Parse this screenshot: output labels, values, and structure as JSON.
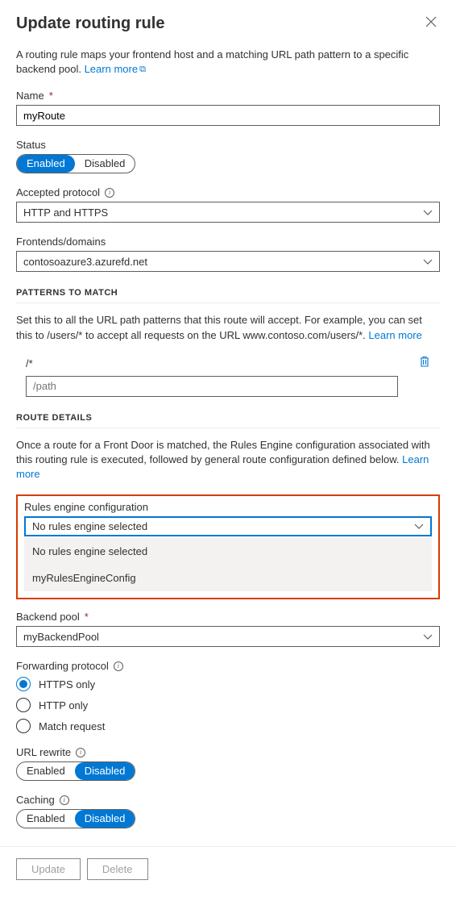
{
  "header": {
    "title": "Update routing rule"
  },
  "intro": {
    "text": "A routing rule maps your frontend host and a matching URL path pattern to a specific backend pool. ",
    "learn_more": "Learn more"
  },
  "name": {
    "label": "Name",
    "value": "myRoute"
  },
  "status": {
    "label": "Status",
    "enabled": "Enabled",
    "disabled": "Disabled"
  },
  "accepted_protocol": {
    "label": "Accepted protocol",
    "value": "HTTP and HTTPS"
  },
  "frontends": {
    "label": "Frontends/domains",
    "value": "contosoazure3.azurefd.net"
  },
  "patterns": {
    "heading": "PATTERNS TO MATCH",
    "desc": "Set this to all the URL path patterns that this route will accept. For example, you can set this to /users/* to accept all requests on the URL www.contoso.com/users/*. ",
    "learn_more": "Learn more",
    "existing": "/*",
    "placeholder": "/path"
  },
  "route_details": {
    "heading": "ROUTE DETAILS",
    "desc": "Once a route for a Front Door is matched, the Rules Engine configuration associated with this routing rule is executed, followed by general route configuration defined below. ",
    "learn_more": "Learn more"
  },
  "rules_engine": {
    "label": "Rules engine configuration",
    "selected": "No rules engine selected",
    "options": [
      "No rules engine selected",
      "myRulesEngineConfig"
    ]
  },
  "backend_pool": {
    "label": "Backend pool",
    "value": "myBackendPool"
  },
  "forwarding_protocol": {
    "label": "Forwarding protocol",
    "options": [
      "HTTPS only",
      "HTTP only",
      "Match request"
    ]
  },
  "url_rewrite": {
    "label": "URL rewrite",
    "enabled": "Enabled",
    "disabled": "Disabled"
  },
  "caching": {
    "label": "Caching",
    "enabled": "Enabled",
    "disabled": "Disabled"
  },
  "footer": {
    "update": "Update",
    "delete": "Delete"
  }
}
